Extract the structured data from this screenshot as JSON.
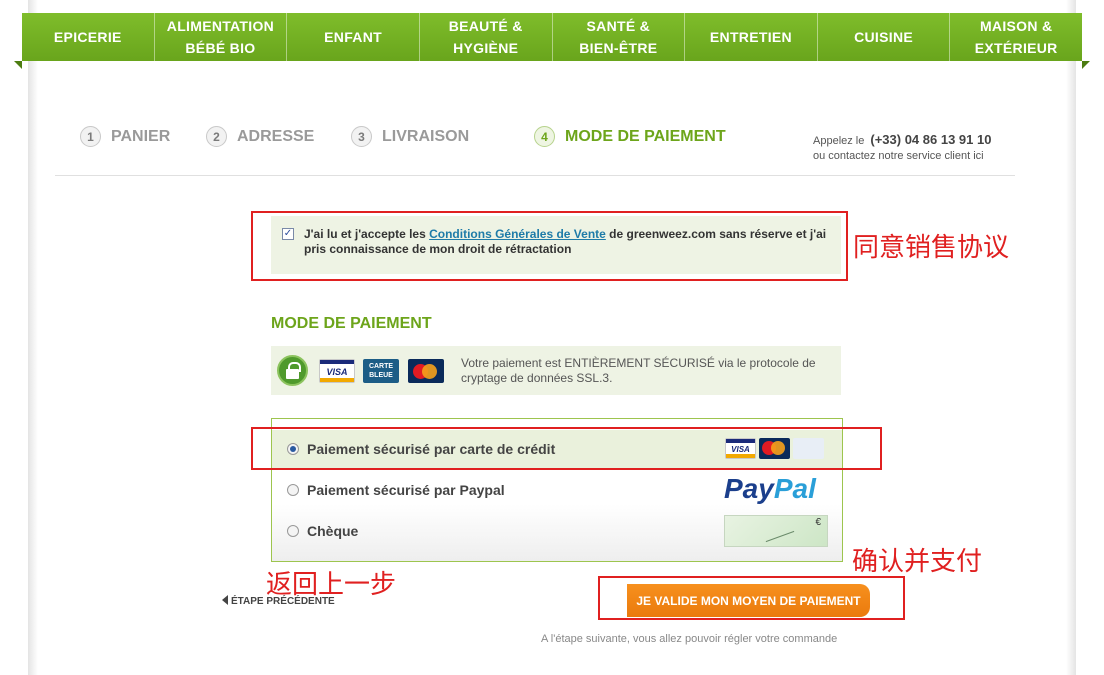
{
  "nav": {
    "items": [
      "EPICERIE",
      "ALIMENTATION\nBÉBÉ BIO",
      "ENFANT",
      "BEAUTÉ &\nHYGIÈNE",
      "SANTÉ &\nBIEN-ÊTRE",
      "ENTRETIEN",
      "CUISINE",
      "MAISON &\nEXTÉRIEUR"
    ]
  },
  "steps": [
    {
      "num": "1",
      "label": "PANIER"
    },
    {
      "num": "2",
      "label": "ADRESSE"
    },
    {
      "num": "3",
      "label": "LIVRAISON"
    },
    {
      "num": "4",
      "label": "MODE DE PAIEMENT"
    }
  ],
  "contact": {
    "prefix": "Appelez le",
    "phone": "(+33) 04 86 13 91 10",
    "line2": "ou contactez notre service client ici"
  },
  "terms": {
    "checked": true,
    "before": "J'ai lu et j'accepte les ",
    "link": "Conditions Générales de Vente",
    "after": " de greenweez.com sans réserve et j'ai pris connaissance de mon droit de rétractation"
  },
  "annotations": {
    "agree": "同意销售协议",
    "confirm": "确认并支付",
    "back": "返回上一步"
  },
  "payment": {
    "title": "MODE DE PAIEMENT",
    "secure_text": "Votre paiement est ENTIÈREMENT SÉCURISÉ via le protocole de cryptage de données SSL.3.",
    "cards": {
      "visa": "VISA",
      "carte_bleue": "CARTE BLEUE",
      "mastercard": "MasterCard"
    },
    "methods": [
      {
        "label": "Paiement sécurisé par carte de crédit",
        "selected": true
      },
      {
        "label": "Paiement sécurisé par Paypal",
        "selected": false
      },
      {
        "label": "Chèque",
        "selected": false
      }
    ],
    "paypal_logo": {
      "pay": "Pay",
      "pal": "Pal"
    }
  },
  "footer": {
    "back_label": "ÉTAPE PRÉCÉDENTE",
    "validate_label": "JE VALIDE MON MOYEN DE PAIEMENT",
    "next_note": "A l'étape suivante, vous allez pouvoir régler votre commande"
  },
  "colors": {
    "green": "#6da51b",
    "orange": "#f7901e",
    "annotation_red": "#e02020"
  }
}
